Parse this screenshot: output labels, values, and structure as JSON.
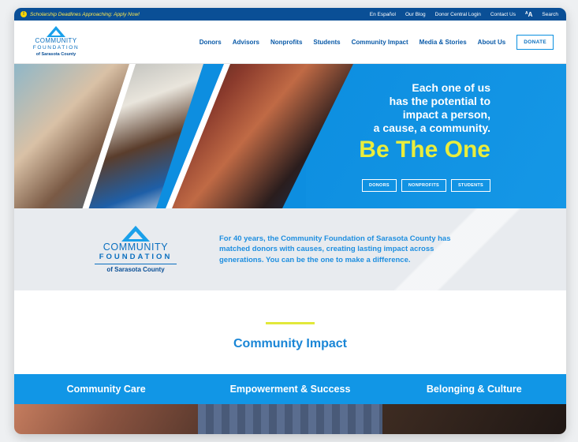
{
  "utility": {
    "alert": "Scholarship Deadlines Approaching: Apply Now!",
    "links": [
      "En Español",
      "Our Blog",
      "Donor Central Login",
      "Contact Us"
    ],
    "font_toggle": "A",
    "search": "Search"
  },
  "logo": {
    "line1": "COMMUNITY",
    "line2": "FOUNDATION",
    "line3": "of Sarasota County"
  },
  "nav": {
    "items": [
      "Donors",
      "Advisors",
      "Nonprofits",
      "Students",
      "Community Impact",
      "Media & Stories",
      "About Us"
    ],
    "donate": "DONATE"
  },
  "hero": {
    "lines": [
      "Each one of us",
      "has the potential to",
      "impact a person,",
      "a cause, a community."
    ],
    "headline": "Be The One",
    "buttons": [
      "DONORS",
      "NONPROFITS",
      "STUDENTS"
    ]
  },
  "intro": {
    "text": "For 40 years, the Community Foundation of Sarasota County has matched donors with causes, creating lasting impact across generations. You can be the one to make a difference."
  },
  "impact": {
    "title": "Community Impact",
    "categories": [
      "Community Care",
      "Empowerment & Success",
      "Belonging & Culture"
    ]
  },
  "colors": {
    "utility_bar": "#0a4f96",
    "brand_blue": "#0d8ee0",
    "accent_yellow": "#e9ed3c"
  }
}
